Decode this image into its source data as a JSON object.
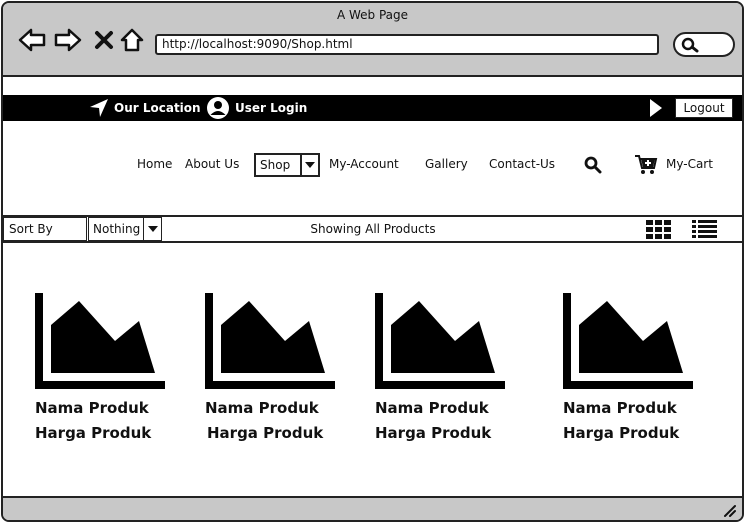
{
  "window": {
    "title": "A Web Page"
  },
  "browser": {
    "url": "http://localhost:9090/Shop.html"
  },
  "topbar": {
    "location": "Our Location",
    "login": "User Login",
    "logout": "Logout"
  },
  "nav": {
    "home": "Home",
    "about": "About Us",
    "shop": "Shop",
    "account": "My-Account",
    "gallery": "Gallery",
    "contact": "Contact-Us",
    "cart": "My-Cart"
  },
  "sortbar": {
    "sort_label": "Sort By",
    "sort_value": "Nothing",
    "showing": "Showing All Products"
  },
  "products": [
    {
      "name": "Nama Produk",
      "price": "Harga Produk"
    },
    {
      "name": "Nama Produk",
      "price": "Harga Produk"
    },
    {
      "name": "Nama Produk",
      "price": "Harga Produk"
    },
    {
      "name": "Nama Produk",
      "price": "Harga Produk"
    }
  ]
}
